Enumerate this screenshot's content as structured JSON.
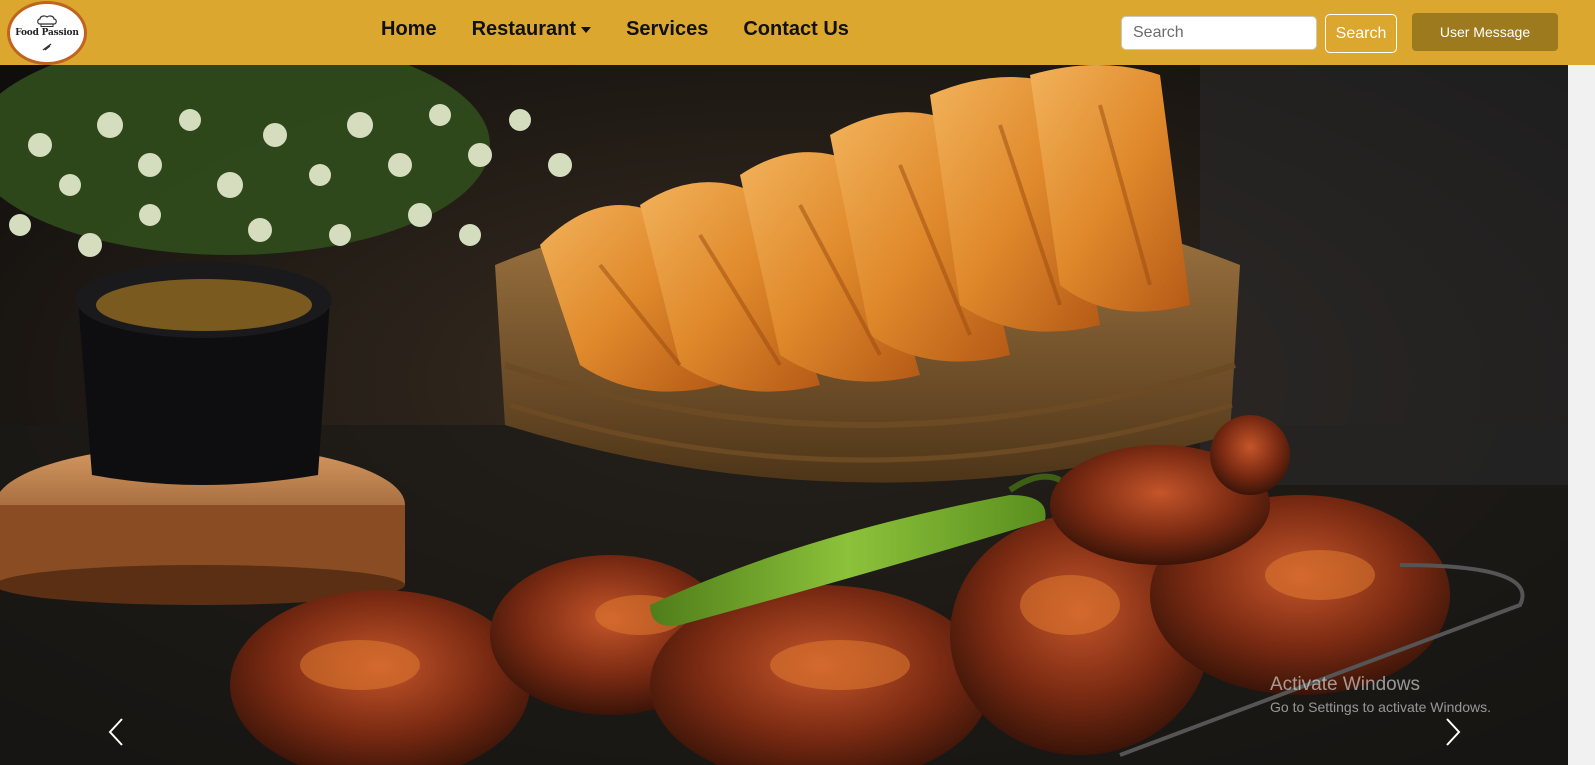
{
  "brand": {
    "logo_text": "Food Passion",
    "logo_icon": "chef-hat-icon",
    "colors": {
      "navbar": "#dba72f",
      "user_button": "#9e7a1f",
      "logo_ring": "#c0631e"
    }
  },
  "nav": {
    "items": [
      {
        "label": "Home"
      },
      {
        "label": "Restaurant",
        "dropdown": true
      },
      {
        "label": "Services"
      },
      {
        "label": "Contact Us"
      }
    ]
  },
  "search": {
    "placeholder": "Search",
    "button_label": "Search"
  },
  "user_button": {
    "label": "User Message"
  },
  "carousel": {
    "prev_icon": "chevron-left-icon",
    "next_icon": "chevron-right-icon"
  },
  "watermark": {
    "title": "Activate Windows",
    "subtitle": "Go to Settings to activate Windows."
  }
}
